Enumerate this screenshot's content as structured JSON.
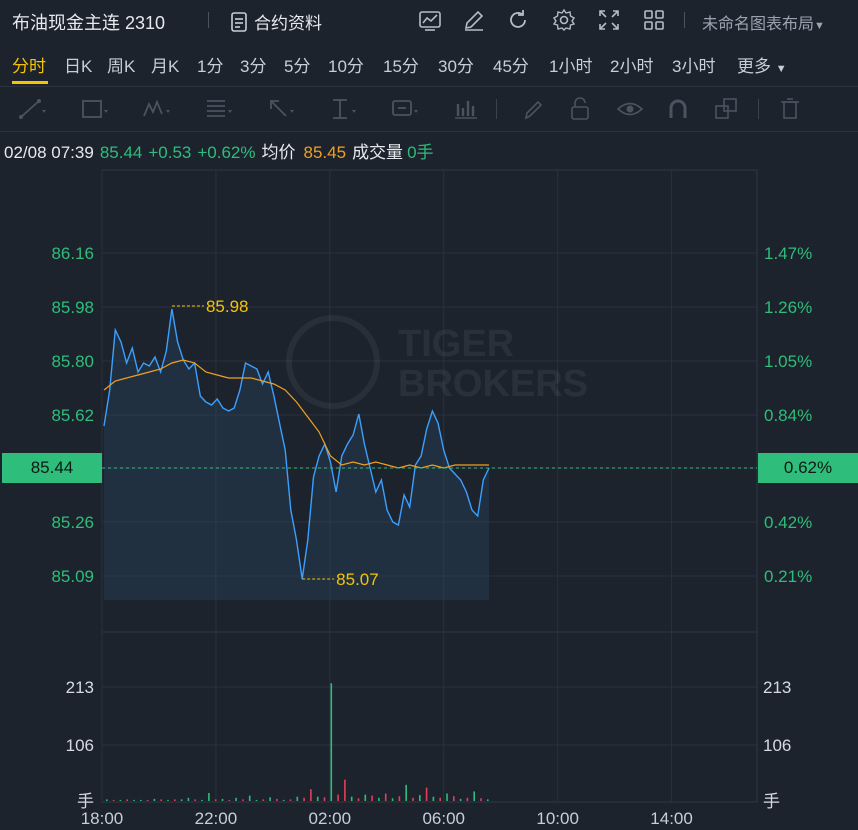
{
  "header": {
    "title": "布油现金主连 2310",
    "contract_info_label": "合约资料",
    "layout_label": "未命名图表布局"
  },
  "periods": [
    "分时",
    "日K",
    "周K",
    "月K",
    "1分",
    "3分",
    "5分",
    "10分",
    "15分",
    "30分",
    "45分",
    "1小时",
    "2小时",
    "3小时",
    "更多"
  ],
  "active_period": "分时",
  "status": {
    "datetime": "02/08 07:39",
    "price": "85.44",
    "change": "+0.53",
    "change_pct": "+0.62%",
    "avg_label": "均价",
    "avg_value": "85.45",
    "volume_label": "成交量",
    "volume_value": "0手"
  },
  "colors": {
    "background": "#1c232d",
    "price_line": "#3aa0ff",
    "avg_line": "#f0a020",
    "up_green": "#2ebd7a",
    "down_red": "#e0405a",
    "highlight": "#f5c400"
  },
  "watermark": [
    "TIGER",
    "BROKERS"
  ],
  "chart_data": {
    "type": "line",
    "x_ticks": [
      "18:00",
      "22:00",
      "02:00",
      "06:00",
      "10:00",
      "14:00"
    ],
    "price_ticks": [
      "86.16",
      "85.98",
      "85.80",
      "85.62",
      "85.44",
      "85.26",
      "85.09"
    ],
    "pct_ticks": [
      "1.47%",
      "1.26%",
      "1.05%",
      "0.84%",
      "0.62%",
      "0.42%",
      "0.21%"
    ],
    "current_price_tag": "85.44",
    "current_pct_tag": "0.62%",
    "high_label": "85.98",
    "low_label": "85.07",
    "volume_ticks": [
      "213",
      "106",
      "手"
    ],
    "volume_ticks_right": [
      "213",
      "106",
      "手"
    ],
    "series": [
      {
        "name": "价格",
        "x": [
          0,
          1,
          2,
          3,
          4,
          5,
          6,
          7,
          8,
          9,
          10,
          11,
          12,
          13,
          14,
          15,
          16,
          17,
          18,
          19,
          20,
          21,
          22,
          23,
          24,
          25,
          26,
          27,
          28,
          29,
          30,
          31,
          32,
          33,
          34,
          35,
          36,
          37,
          38,
          39,
          40,
          41,
          42,
          43,
          44,
          45,
          46,
          47,
          48,
          49,
          50,
          51,
          52,
          53,
          54,
          55,
          56,
          57,
          58,
          59,
          60,
          61,
          62,
          63,
          64,
          65,
          66,
          67,
          68
        ],
        "y": [
          85.58,
          85.7,
          85.9,
          85.86,
          85.79,
          85.84,
          85.76,
          85.79,
          85.78,
          85.81,
          85.76,
          85.83,
          85.97,
          85.86,
          85.8,
          85.77,
          85.79,
          85.68,
          85.66,
          85.65,
          85.67,
          85.64,
          85.63,
          85.64,
          85.7,
          85.79,
          85.78,
          85.77,
          85.72,
          85.76,
          85.68,
          85.59,
          85.5,
          85.3,
          85.2,
          85.07,
          85.2,
          85.41,
          85.48,
          85.52,
          85.46,
          85.36,
          85.48,
          85.52,
          85.55,
          85.62,
          85.52,
          85.44,
          85.36,
          85.4,
          85.3,
          85.26,
          85.25,
          85.35,
          85.31,
          85.45,
          85.48,
          85.57,
          85.63,
          85.59,
          85.5,
          85.44,
          85.42,
          85.4,
          85.36,
          85.3,
          85.28,
          85.4,
          85.44
        ]
      },
      {
        "name": "均价",
        "x": [
          0,
          2,
          4,
          6,
          8,
          10,
          12,
          14,
          16,
          18,
          20,
          22,
          24,
          26,
          28,
          30,
          32,
          34,
          36,
          38,
          40,
          42,
          44,
          46,
          48,
          50,
          52,
          54,
          56,
          58,
          60,
          62,
          64,
          66,
          68
        ],
        "y": [
          85.7,
          85.73,
          85.74,
          85.75,
          85.76,
          85.77,
          85.79,
          85.8,
          85.79,
          85.76,
          85.75,
          85.74,
          85.74,
          85.74,
          85.73,
          85.72,
          85.7,
          85.66,
          85.61,
          85.56,
          85.48,
          85.45,
          85.46,
          85.45,
          85.46,
          85.45,
          85.44,
          85.45,
          85.44,
          85.45,
          85.44,
          85.45,
          85.45,
          85.45,
          85.45
        ]
      }
    ],
    "volume": [
      3,
      2,
      2,
      3,
      2,
      2,
      2,
      4,
      3,
      2,
      3,
      3,
      6,
      3,
      2,
      15,
      3,
      4,
      2,
      6,
      3,
      10,
      2,
      3,
      7,
      4,
      2,
      3,
      8,
      6,
      22,
      8,
      7,
      220,
      12,
      40,
      8,
      5,
      12,
      10,
      6,
      14,
      5,
      9,
      30,
      6,
      11,
      25,
      8,
      6,
      14,
      9,
      4,
      6,
      18,
      5,
      3
    ],
    "volume_colors": [
      "g",
      "r",
      "g",
      "r",
      "g",
      "g",
      "r",
      "g",
      "r",
      "g",
      "r",
      "g",
      "g",
      "r",
      "g",
      "g",
      "r",
      "g",
      "r",
      "g",
      "r",
      "g",
      "g",
      "r",
      "g",
      "r",
      "g",
      "r",
      "g",
      "r",
      "r",
      "g",
      "r",
      "g",
      "r",
      "r",
      "g",
      "r",
      "g",
      "r",
      "g",
      "r",
      "g",
      "r",
      "g",
      "r",
      "g",
      "r",
      "g",
      "r",
      "g",
      "r",
      "g",
      "r",
      "g",
      "r",
      "g"
    ]
  }
}
